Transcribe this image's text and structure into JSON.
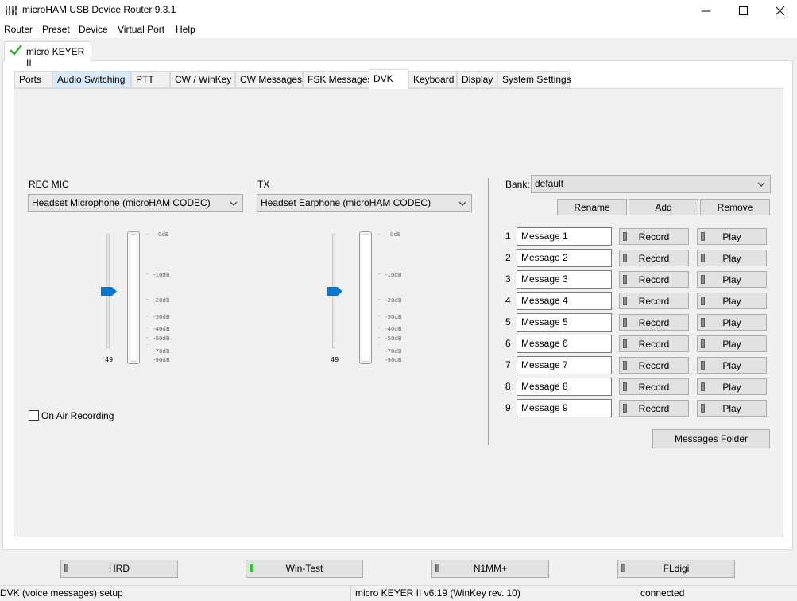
{
  "window": {
    "title": "microHAM USB Device Router 9.3.1"
  },
  "menu": [
    "Router",
    "Preset",
    "Device",
    "Virtual Port",
    "Help"
  ],
  "device_tab": {
    "label": "micro KEYER II"
  },
  "tabs": [
    "Ports",
    "Audio Switching",
    "PTT",
    "CW / WinKey",
    "CW Messages",
    "FSK Messages",
    "DVK",
    "Keyboard",
    "Display",
    "System Settings"
  ],
  "active_tab": "DVK",
  "rec": {
    "label": "REC MIC",
    "device": "Headset Microphone (microHAM CODEC)",
    "slider_value": "49"
  },
  "tx": {
    "label": "TX",
    "device": "Headset Earphone (microHAM CODEC)",
    "slider_value": "49"
  },
  "db_scale": [
    "0dB",
    "-10dB",
    "-20dB",
    "-30dB",
    "-40dB",
    "-50dB",
    "-70dB",
    "-90dB"
  ],
  "on_air_recording": {
    "label": "On Air Recording",
    "checked": false
  },
  "bank": {
    "label": "Bank:",
    "value": "default",
    "rename": "Rename",
    "add": "Add",
    "remove": "Remove"
  },
  "messages": [
    {
      "num": "1",
      "name": "Message 1"
    },
    {
      "num": "2",
      "name": "Message 2"
    },
    {
      "num": "3",
      "name": "Message 3"
    },
    {
      "num": "4",
      "name": "Message 4"
    },
    {
      "num": "5",
      "name": "Message 5"
    },
    {
      "num": "6",
      "name": "Message 6"
    },
    {
      "num": "7",
      "name": "Message 7"
    },
    {
      "num": "8",
      "name": "Message 8"
    },
    {
      "num": "9",
      "name": "Message 9"
    }
  ],
  "record_label": "Record",
  "play_label": "Play",
  "messages_folder": "Messages Folder",
  "bottom_buttons": [
    {
      "label": "HRD",
      "active": false
    },
    {
      "label": "Win-Test",
      "active": true
    },
    {
      "label": "N1MM+",
      "active": false
    },
    {
      "label": "FLdigi",
      "active": false
    }
  ],
  "status": {
    "left": "DVK (voice messages) setup",
    "middle": "micro KEYER II v6.19 (WinKey rev. 10)",
    "right": "connected"
  },
  "colors": {
    "accent": "#0078d7",
    "led_on": "#1fd21f",
    "led_off": "#8a8a8a",
    "check": "#2eae2e"
  }
}
